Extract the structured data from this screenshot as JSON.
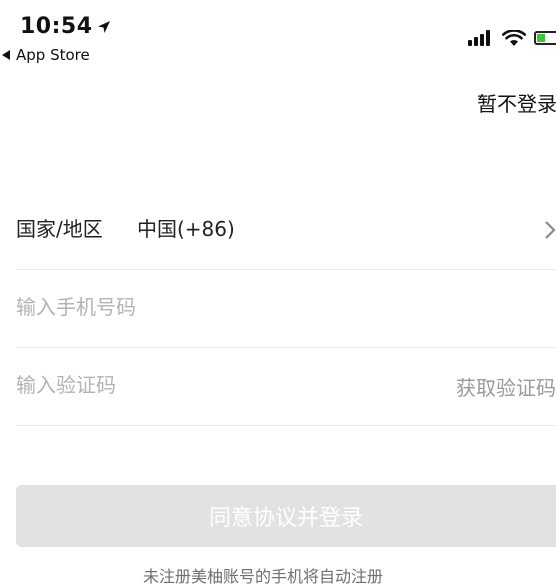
{
  "status_bar": {
    "time": "10:54",
    "back_app": "App Store",
    "icons": [
      "location-arrow-icon",
      "cellular-signal-icon",
      "wifi-icon",
      "battery-charging-icon"
    ],
    "battery_level": 0.4,
    "battery_color": "#3ec43a"
  },
  "header": {
    "skip_label": "暂不登录"
  },
  "form": {
    "country_label": "国家/地区",
    "country_value": "中国(+86)",
    "phone_placeholder": "输入手机号码",
    "phone_value": "",
    "code_placeholder": "输入验证码",
    "code_value": "",
    "get_code_label": "获取验证码"
  },
  "actions": {
    "submit_label": "同意协议并登录",
    "hint": "未注册美柚账号的手机将自动注册"
  }
}
